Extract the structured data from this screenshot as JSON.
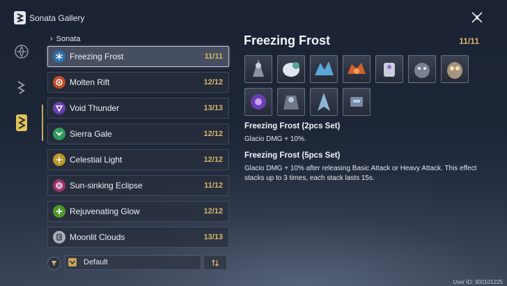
{
  "app": {
    "title": "Sonata Gallery",
    "icon": "sonata-app-icon"
  },
  "rail": [
    {
      "name": "rail-echo-icon",
      "active": false
    },
    {
      "name": "rail-tune-icon",
      "active": false
    },
    {
      "name": "rail-sonata-icon",
      "active": true
    }
  ],
  "list": {
    "header": "Sonata",
    "sets": [
      {
        "name": "Freezing Frost",
        "count": "11/11",
        "color": "#5aa7d8",
        "icon": "snowflake-icon",
        "selected": true
      },
      {
        "name": "Molten Rift",
        "count": "12/12",
        "color": "#e0643a",
        "icon": "flame-icon",
        "selected": false
      },
      {
        "name": "Void Thunder",
        "count": "13/13",
        "color": "#9b6ad8",
        "icon": "thunder-icon",
        "selected": false
      },
      {
        "name": "Sierra Gale",
        "count": "12/12",
        "color": "#5dc48a",
        "icon": "wind-icon",
        "selected": false
      },
      {
        "name": "Celestial Light",
        "count": "12/12",
        "color": "#e2c34a",
        "icon": "sun-icon",
        "selected": false
      },
      {
        "name": "Sun-sinking Eclipse",
        "count": "11/12",
        "color": "#c04a86",
        "icon": "eclipse-icon",
        "selected": false
      },
      {
        "name": "Rejuvenating Glow",
        "count": "12/12",
        "color": "#7cc24c",
        "icon": "heal-icon",
        "selected": false
      },
      {
        "name": "Moonlit Clouds",
        "count": "13/13",
        "color": "#c9ccd4",
        "icon": "cloud-icon",
        "selected": false
      }
    ]
  },
  "filter": {
    "sort_label": "Default",
    "icon": "filter-icon",
    "order_icon": "sort-order-icon"
  },
  "detail": {
    "title": "Freezing Frost",
    "count": "11/11",
    "echo_count": 11,
    "effects": [
      {
        "name": "Freezing Frost (2pcs Set)",
        "desc": "Glacio DMG + 10%."
      },
      {
        "name": "Freezing Frost (5pcs Set)",
        "desc": "Glacio DMG + 10% after releasing Basic Attack or Heavy Attack. This effect stacks up to 3 times, each stack lasts 15s."
      }
    ]
  },
  "uid": "User ID: 900101225",
  "colors": {
    "accent": "#d8b76c",
    "selected_border": "#dce1eb"
  }
}
